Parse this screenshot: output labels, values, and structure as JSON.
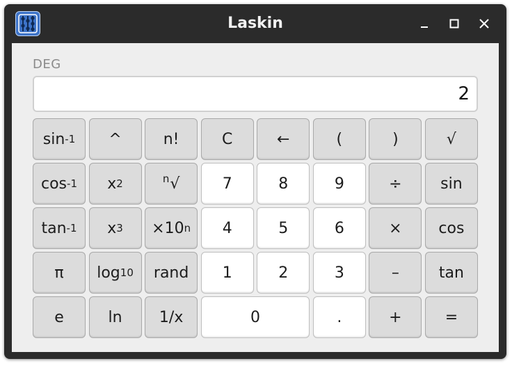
{
  "window": {
    "title": "Laskin",
    "icon": "abacus-icon"
  },
  "mode": "DEG",
  "display": {
    "value": "2"
  },
  "keys": {
    "asin": {
      "base": "sin",
      "sup": "-1"
    },
    "pow": "^",
    "fact": "n!",
    "clear": "C",
    "backspace": "←",
    "lparen": "(",
    "rparen": ")",
    "sqrt": "√",
    "acos": {
      "base": "cos",
      "sup": "-1"
    },
    "square": {
      "base": "x",
      "sup": "2"
    },
    "nroot": {
      "sup": "n",
      "base": "√"
    },
    "n7": "7",
    "n8": "8",
    "n9": "9",
    "div": "÷",
    "sin": "sin",
    "atan": {
      "base": "tan",
      "sup": "-1"
    },
    "cube": {
      "base": "x",
      "sup": "3"
    },
    "exp10": {
      "base": "×10",
      "sup": "n"
    },
    "n4": "4",
    "n5": "5",
    "n6": "6",
    "mul": "×",
    "cos": "cos",
    "pi": "π",
    "log10": {
      "base": "log",
      "sub": "10"
    },
    "rand": "rand",
    "n1": "1",
    "n2": "2",
    "n3": "3",
    "minus": "–",
    "tan": "tan",
    "e": "e",
    "ln": "ln",
    "recip": "1/x",
    "n0": "0",
    "dot": ".",
    "plus": "+",
    "equals": "="
  }
}
